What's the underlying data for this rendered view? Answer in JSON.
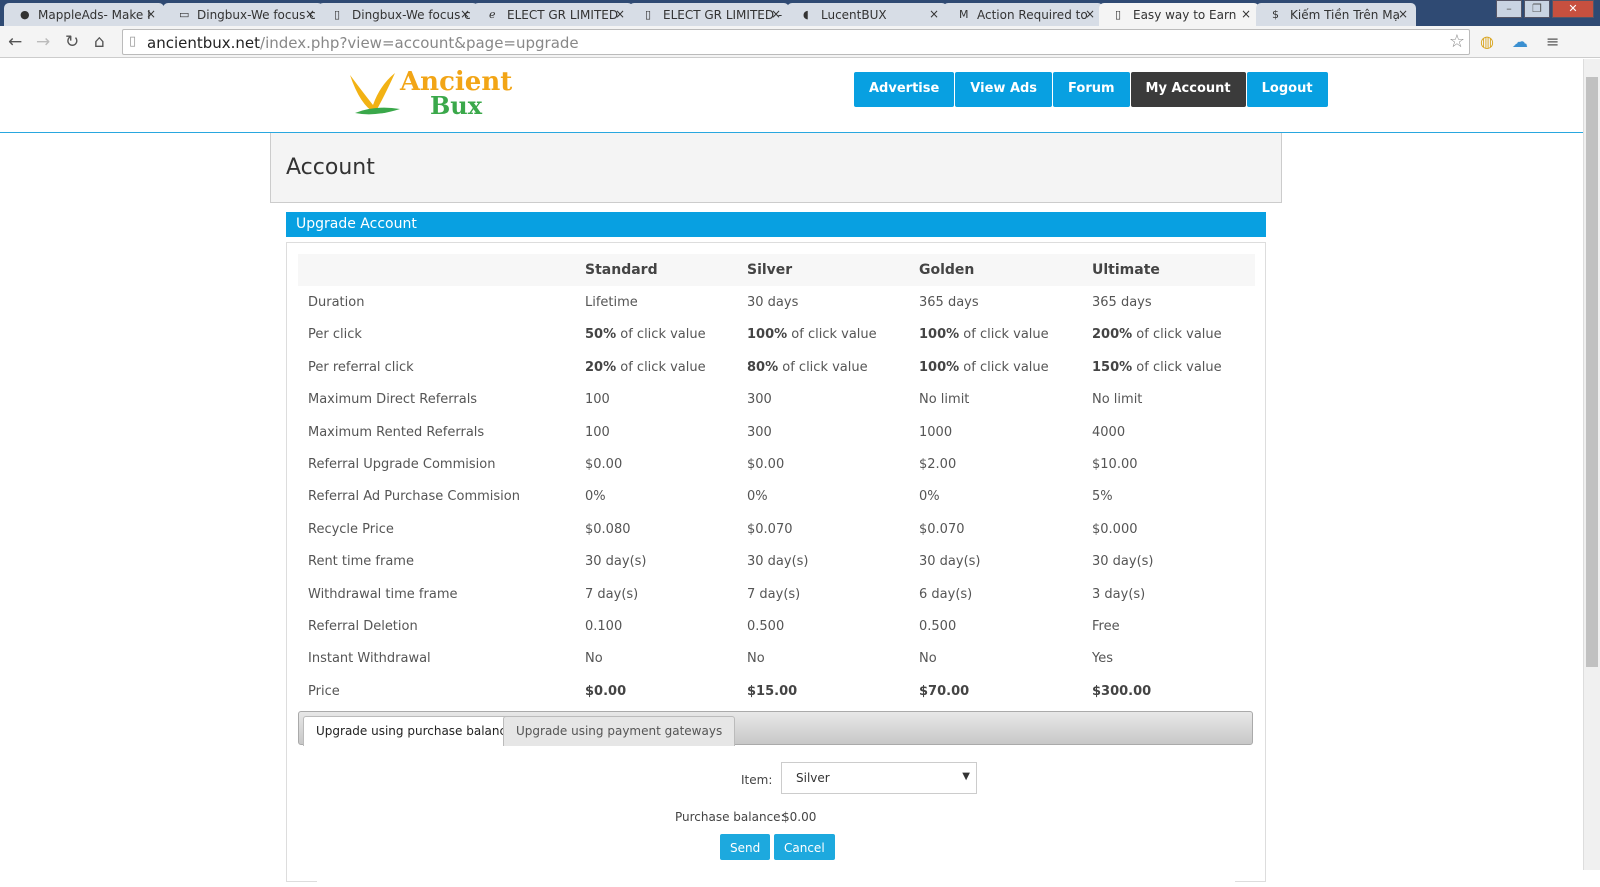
{
  "browser": {
    "tabs": [
      {
        "title": "MappleAds- Make I",
        "icon": "map-pin-icon"
      },
      {
        "title": "Dingbux-We focus c",
        "icon": "laptop-icon"
      },
      {
        "title": "Dingbux-We focus c",
        "icon": "page-icon"
      },
      {
        "title": "ELECT GR LIMITED",
        "icon": "e-logo-icon"
      },
      {
        "title": "ELECT GR LIMITED -",
        "icon": "page-icon"
      },
      {
        "title": "LucentBUX",
        "icon": "drop-icon"
      },
      {
        "title": "Action Required to",
        "icon": "gmail-icon"
      },
      {
        "title": "Easy way to Earn",
        "icon": "page-icon"
      },
      {
        "title": "Kiếm Tiền Trên Mạ",
        "icon": "dollar-icon"
      }
    ],
    "url_domain": "ancientbux.net",
    "url_path": "/index.php?view=account&page=upgrade"
  },
  "site": {
    "logo_line1": "Ancient",
    "logo_line2": "Bux",
    "nav": [
      "Advertise",
      "View Ads",
      "Forum",
      "My Account",
      "Logout"
    ],
    "active_nav": "My Account"
  },
  "page": {
    "title": "Account",
    "panel_title": "Upgrade Account"
  },
  "table": {
    "headers": [
      "",
      "Standard",
      "Silver",
      "Golden",
      "Ultimate"
    ],
    "rows": [
      {
        "label": "Duration",
        "cells": [
          {
            "t": "Lifetime"
          },
          {
            "t": "30 days"
          },
          {
            "t": "365 days"
          },
          {
            "t": "365 days"
          }
        ]
      },
      {
        "label": "Per click",
        "cells": [
          {
            "b": "50%",
            "t": " of click value"
          },
          {
            "b": "100%",
            "t": " of click value"
          },
          {
            "b": "100%",
            "t": " of click value"
          },
          {
            "b": "200%",
            "t": " of click value"
          }
        ]
      },
      {
        "label": "Per referral click",
        "cells": [
          {
            "b": "20%",
            "t": " of click value"
          },
          {
            "b": "80%",
            "t": " of click value"
          },
          {
            "b": "100%",
            "t": " of click value"
          },
          {
            "b": "150%",
            "t": " of click value"
          }
        ]
      },
      {
        "label": "Maximum Direct Referrals",
        "cells": [
          {
            "t": "100"
          },
          {
            "t": "300"
          },
          {
            "t": "No limit"
          },
          {
            "t": "No limit"
          }
        ]
      },
      {
        "label": "Maximum Rented Referrals",
        "cells": [
          {
            "t": "100"
          },
          {
            "t": "300"
          },
          {
            "t": "1000"
          },
          {
            "t": "4000"
          }
        ]
      },
      {
        "label": "Referral Upgrade Commision",
        "cells": [
          {
            "t": "$0.00"
          },
          {
            "t": "$0.00"
          },
          {
            "t": "$2.00"
          },
          {
            "t": "$10.00"
          }
        ]
      },
      {
        "label": "Referral Ad Purchase Commision",
        "cells": [
          {
            "t": "0%"
          },
          {
            "t": "0%"
          },
          {
            "t": "0%"
          },
          {
            "t": "5%"
          }
        ]
      },
      {
        "label": "Recycle Price",
        "cells": [
          {
            "t": "$0.080"
          },
          {
            "t": "$0.070"
          },
          {
            "t": "$0.070"
          },
          {
            "t": "$0.000"
          }
        ]
      },
      {
        "label": "Rent time frame",
        "cells": [
          {
            "t": "30 day(s)"
          },
          {
            "t": "30 day(s)"
          },
          {
            "t": "30 day(s)"
          },
          {
            "t": "30 day(s)"
          }
        ]
      },
      {
        "label": "Withdrawal time frame",
        "cells": [
          {
            "t": "7 day(s)"
          },
          {
            "t": "7 day(s)"
          },
          {
            "t": "6 day(s)"
          },
          {
            "t": "3 day(s)"
          }
        ]
      },
      {
        "label": "Referral Deletion",
        "cells": [
          {
            "t": "0.100"
          },
          {
            "t": "0.500"
          },
          {
            "t": "0.500"
          },
          {
            "t": "Free"
          }
        ]
      },
      {
        "label": "Instant Withdrawal",
        "cells": [
          {
            "t": "No"
          },
          {
            "t": "No"
          },
          {
            "t": "No"
          },
          {
            "t": "Yes"
          }
        ]
      },
      {
        "label": "Price",
        "cells": [
          {
            "b": "$0.00"
          },
          {
            "b": "$15.00"
          },
          {
            "b": "$70.00"
          },
          {
            "b": "$300.00"
          }
        ]
      }
    ]
  },
  "upgrade": {
    "tabs": [
      "Upgrade using purchase balance",
      "Upgrade using payment gateways"
    ],
    "item_label": "Item:",
    "item_value": "Silver",
    "balance_label": "Purchase balance:",
    "balance_value": "$0.00",
    "send": "Send",
    "cancel": "Cancel"
  }
}
